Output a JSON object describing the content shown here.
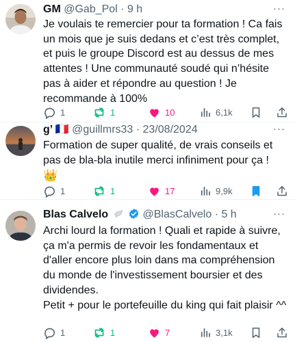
{
  "tweets": [
    {
      "display_name": "GM",
      "handle_time": "@Gab_Pol · 9 h",
      "text": "Je voulais te remercier pour ta formation ! Ca fais un mois que je suis dedans et c’est très complet, et puis le groupe Discord est au dessus de mes attentes ! Une communauté soudé qui n’hésite pas à aider et répondre au question ! Je recommande à 100%",
      "replies": "1",
      "reposts": "1",
      "likes": "10",
      "views": "6,1k"
    },
    {
      "display_name": "g’ 🇫🇷",
      "handle_time": "@guillmrs33 · 23/08/2024",
      "text": "Formation de super qualité, de vrais conseils et pas de bla-bla inutile merci infiniment pour ça !",
      "emoji": "👑",
      "replies": "1",
      "reposts": "1",
      "likes": "17",
      "views": "9,9k"
    },
    {
      "display_name": "Blas Calvelo",
      "handle_time": "@BlasCalvelo · 5 h",
      "text": "Archi lourd la formation ! Quali et rapide à suivre, ça m'a permis de revoir les fondamentaux et d'aller encore plus loin dans ma compréhension du monde de l'investissement boursier et des dividendes.\nPetit + pour le portefeuille du king qui fait plaisir ^^",
      "replies": "1",
      "reposts": "1",
      "likes": "7",
      "views": "3,1k"
    }
  ],
  "more_label": "···",
  "colors": {
    "text": "#0f1419",
    "meta": "#536471",
    "like_active": "#f91880",
    "repost_active": "#00ba7c",
    "bookmark_active": "#1d9bf0",
    "verified": "#1d9bf0"
  },
  "icons": [
    "reply-icon",
    "repost-icon",
    "like-icon",
    "views-icon",
    "bookmark-icon",
    "share-icon",
    "verified-icon",
    "dove-icon"
  ]
}
